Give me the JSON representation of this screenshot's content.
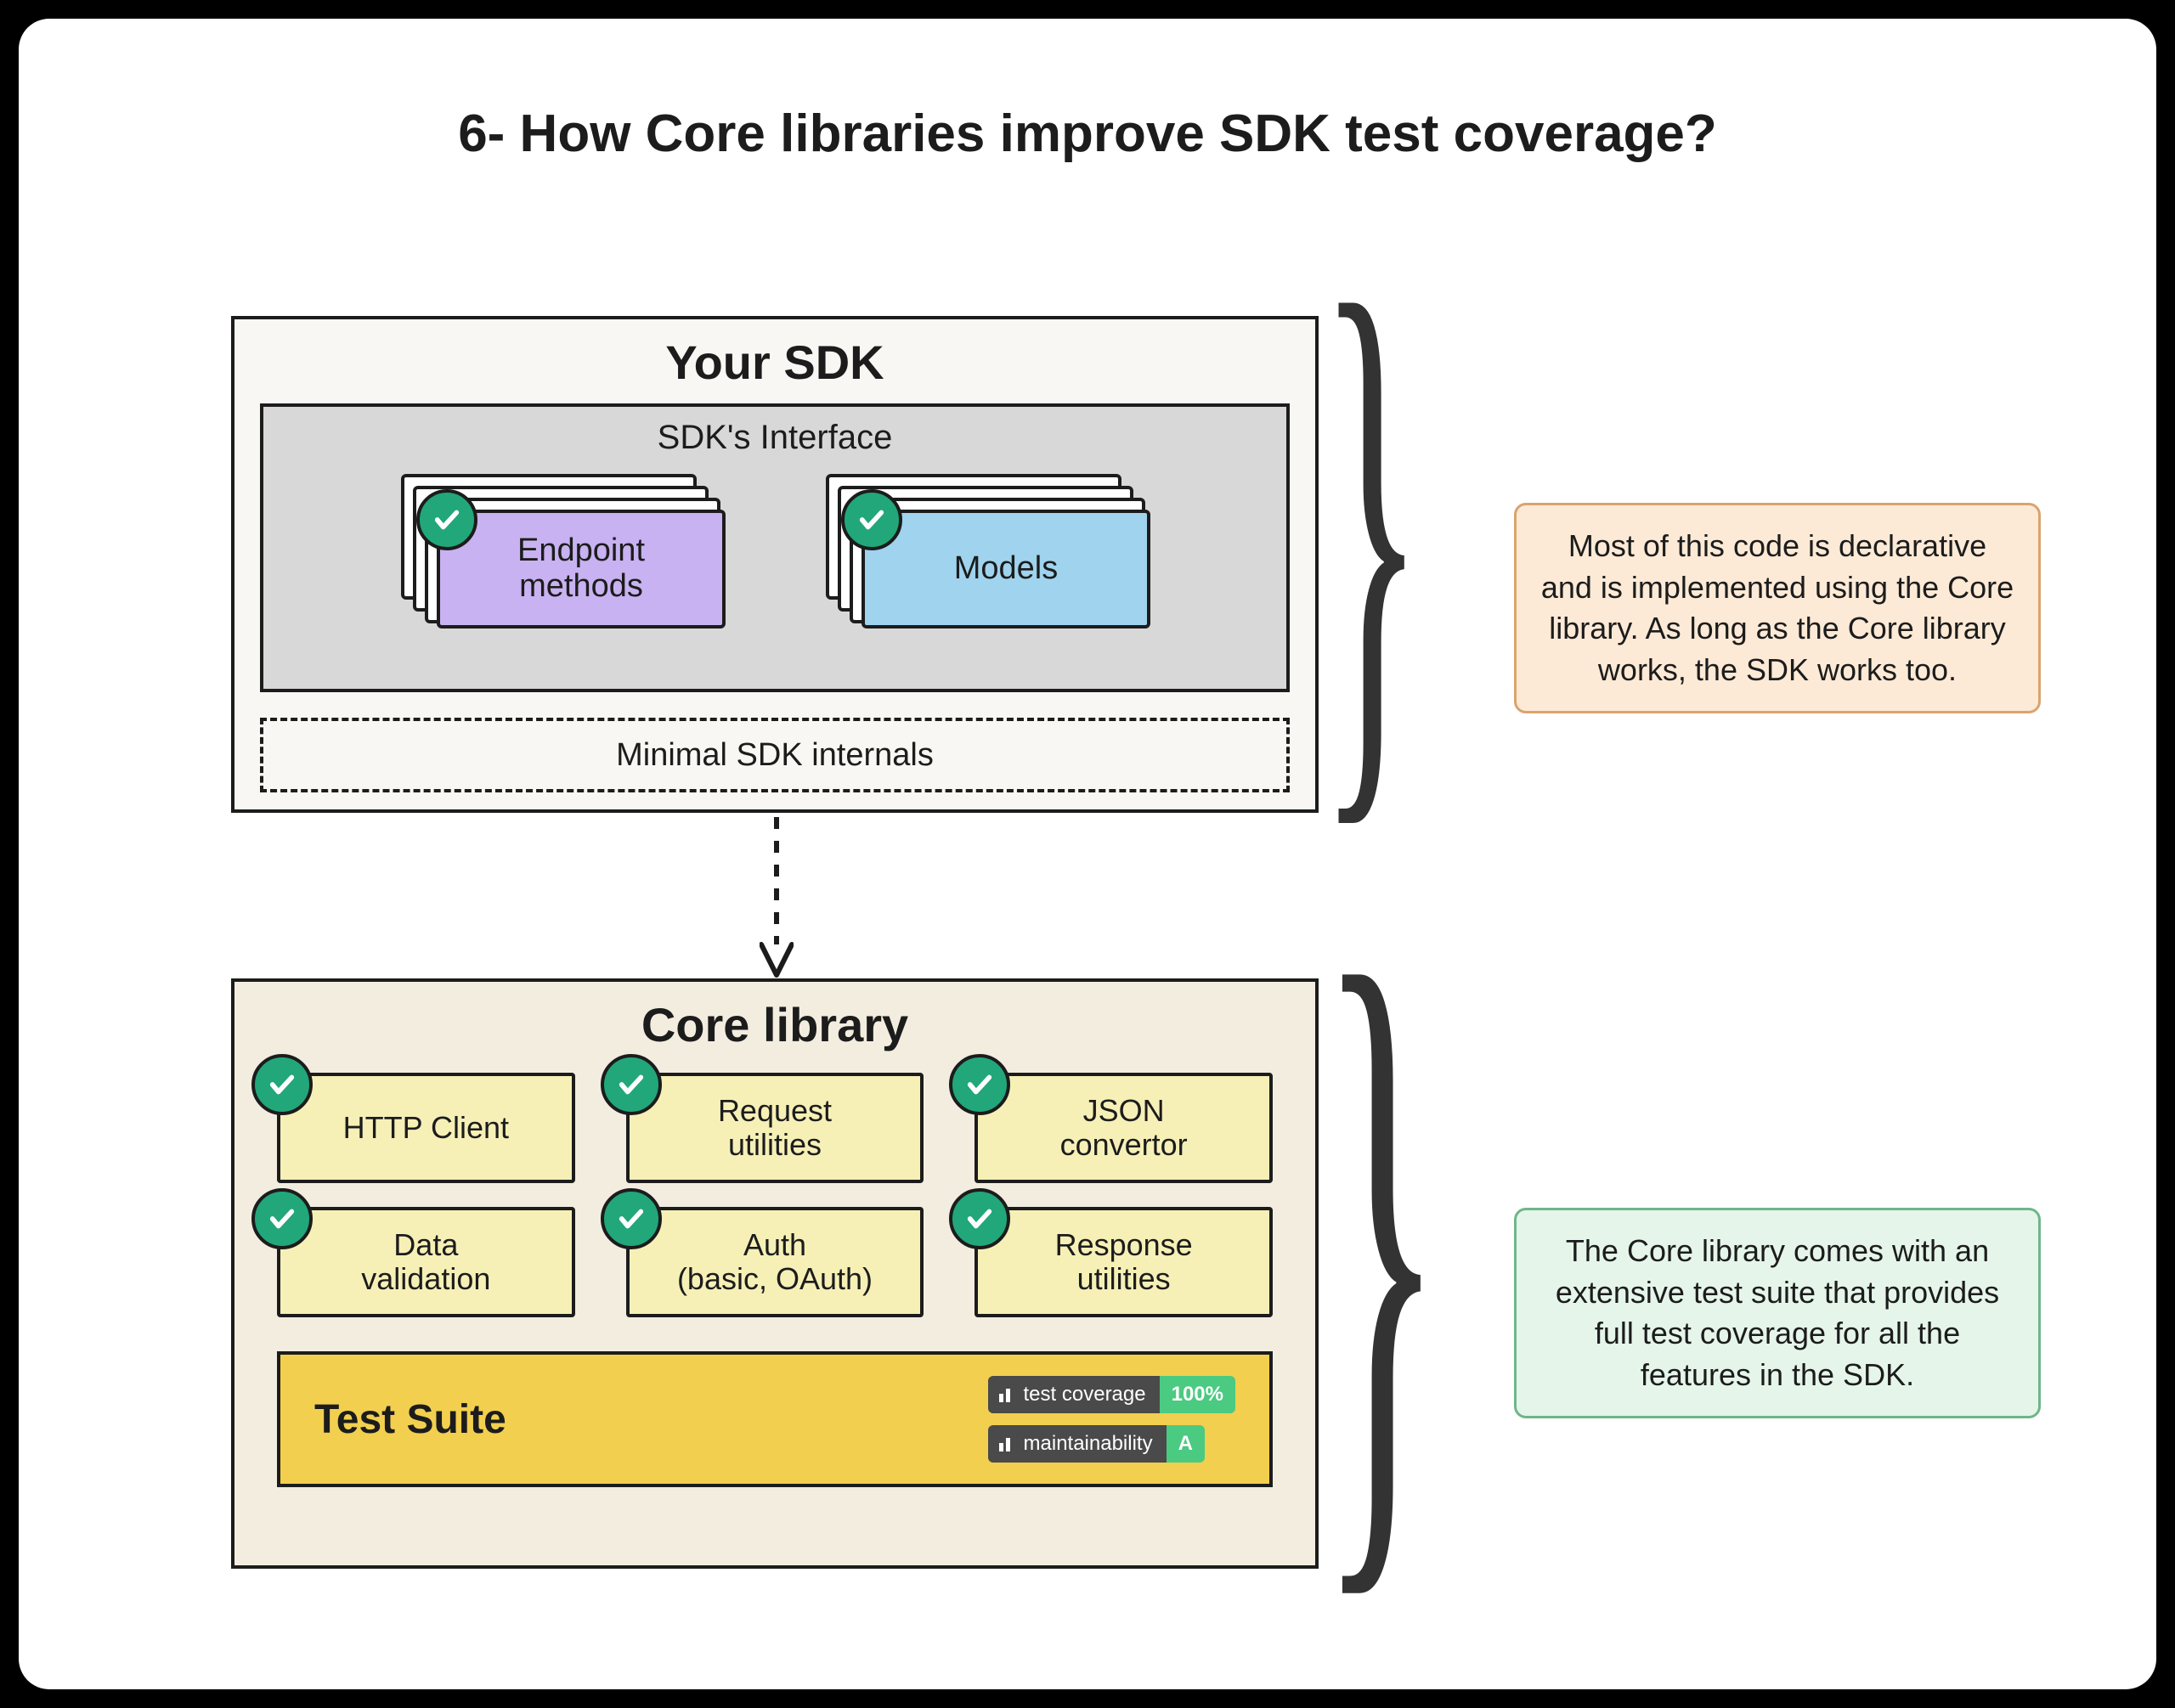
{
  "title": "6- How Core libraries improve SDK test coverage?",
  "sdk": {
    "title": "Your SDK",
    "interface_title": "SDK's Interface",
    "card_endpoint": "Endpoint\nmethods",
    "card_models": "Models",
    "minimal_internals": "Minimal SDK internals"
  },
  "core": {
    "title": "Core library",
    "items": [
      "HTTP Client",
      "Request\nutilities",
      "JSON\nconvertor",
      "Data\nvalidation",
      "Auth\n(basic, OAuth)",
      "Response\nutilities"
    ],
    "test_suite_label": "Test Suite",
    "badge_coverage_label": "test coverage",
    "badge_coverage_value": "100%",
    "badge_maint_label": "maintainability",
    "badge_maint_value": "A"
  },
  "notes": {
    "orange": "Most of this code is declarative and is implemented using the Core library. As long as the Core library works, the SDK works too.",
    "green": "The Core library comes with an extensive test suite that provides full test coverage for all the features in the SDK."
  }
}
